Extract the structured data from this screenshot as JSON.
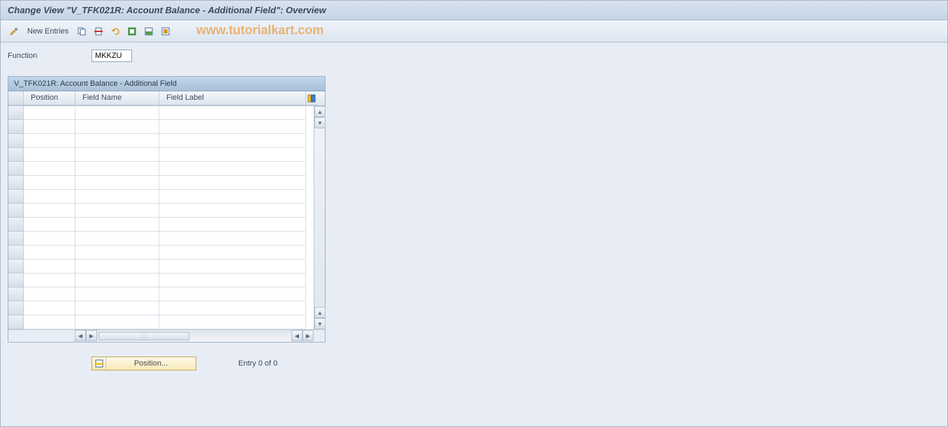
{
  "title": "Change View \"V_TFK021R: Account Balance - Additional Field\": Overview",
  "toolbar": {
    "new_entries": "New Entries"
  },
  "watermark": "www.tutorialkart.com",
  "function": {
    "label": "Function",
    "value": "MKKZU"
  },
  "panel": {
    "title": "V_TFK021R: Account Balance - Additional Field",
    "columns": {
      "position": "Position",
      "field_name": "Field Name",
      "field_label": "Field Label"
    }
  },
  "bottom": {
    "position_button": "Position...",
    "entry_text": "Entry 0 of 0"
  }
}
